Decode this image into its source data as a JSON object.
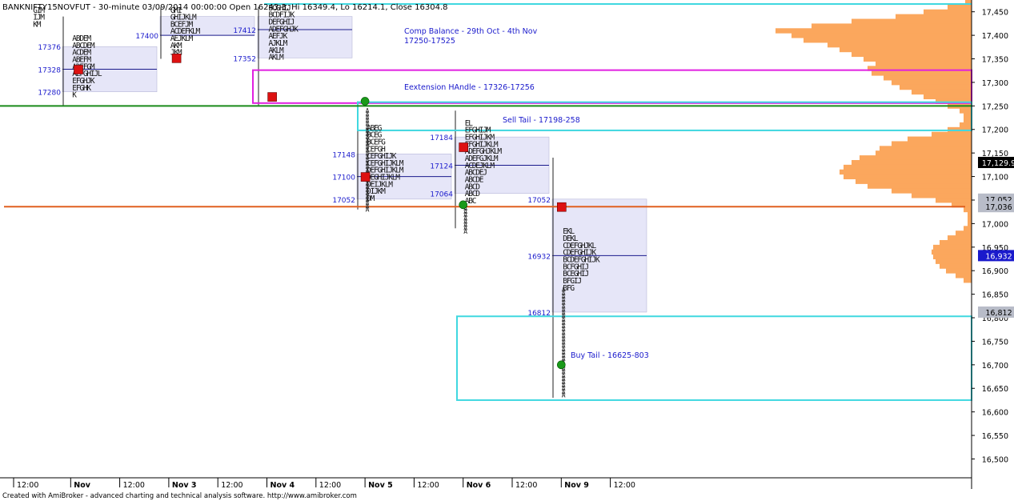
{
  "header": {
    "title": "BANKNIFTY15NOVFUT - 30-minute 03/09/2014 00:00:00 Open 16243.3, Hi 16349.4, Lo 16214.1, Close 16304.8"
  },
  "footer": {
    "credit": "Created with AmiBroker - advanced charting and technical analysis software. http://www.amibroker.com"
  },
  "colors": {
    "profile_fill": "#fba75d",
    "value_area_fill": "#e6e6f8",
    "poc_line": "#1a1a8c",
    "cyan_box": "#40d8e0",
    "magenta_box": "#e020e0",
    "green_line": "#1a8a1a",
    "orange_line": "#e06020",
    "text_blue": "#1a1acc",
    "red_marker": "#dd1111",
    "green_marker": "#1a9a1a"
  },
  "chart_data": {
    "type": "market-profile",
    "title": "BANKNIFTY15NOVFUT - 30-minute 03/09/2014 00:00:00 Open 16243.3, Hi 16349.4, Lo 16214.1, Close 16304.8",
    "xlabel": "",
    "ylabel": "",
    "ylim": [
      16460,
      17475
    ],
    "y_ticks": [
      16500,
      16550,
      16600,
      16650,
      16700,
      16750,
      16800,
      16850,
      16900,
      16950,
      17000,
      17050,
      17100,
      17150,
      17200,
      17250,
      17300,
      17350,
      17400,
      17450
    ],
    "y_tick_labels": [
      "16,500",
      "16,550",
      "16,600",
      "16,650",
      "16,700",
      "16,750",
      "16,800",
      "16,850",
      "16,900",
      "16,950",
      "17,000",
      "17,050",
      "17,100",
      "17,150",
      "17,200",
      "17,250",
      "17,300",
      "17,350",
      "17,400",
      "17,450"
    ],
    "x_labels": [
      {
        "label": "12:00",
        "slot": 0
      },
      {
        "label": "Nov",
        "slot": 1,
        "bold": true
      },
      {
        "label": "12:00",
        "slot": 2
      },
      {
        "label": "Nov 3",
        "slot": 3,
        "bold": true
      },
      {
        "label": "12:00",
        "slot": 4
      },
      {
        "label": "Nov 4",
        "slot": 5,
        "bold": true
      },
      {
        "label": "12:00",
        "slot": 6
      },
      {
        "label": "Nov 5",
        "slot": 7,
        "bold": true
      },
      {
        "label": "12:00",
        "slot": 8
      },
      {
        "label": "Nov 6",
        "slot": 9,
        "bold": true
      },
      {
        "label": "12:00",
        "slot": 10
      },
      {
        "label": "Nov 9",
        "slot": 11,
        "bold": true
      },
      {
        "label": "12:00",
        "slot": 12
      }
    ],
    "value_areas": [
      {
        "day": "Nov",
        "vah": 17376,
        "poc": 17328,
        "val": 17280,
        "hi": 17440,
        "lo": 17250,
        "poc_label": "17328",
        "vah_label": "17376",
        "val_label": "17280"
      },
      {
        "day": "Nov 3",
        "vah": 17440,
        "poc": 17400,
        "val": 17400,
        "hi": 17460,
        "lo": 17350,
        "poc_label": "17400"
      },
      {
        "day": "Nov 4",
        "vah": 17440,
        "poc": 17412,
        "val": 17352,
        "hi": 17460,
        "lo": 17250,
        "poc_label": "17412",
        "val_label": "17352"
      },
      {
        "day": "Nov 5",
        "vah": 17148,
        "poc": 17100,
        "val": 17052,
        "hi": 17260,
        "lo": 17030,
        "poc_label": "17100",
        "vah_label": "17148",
        "val_label": "17052"
      },
      {
        "day": "Nov 6",
        "vah": 17184,
        "poc": 17124,
        "val": 17064,
        "hi": 17240,
        "lo": 16990,
        "poc_label": "17124",
        "vah_label": "17184",
        "val_label": "17064"
      },
      {
        "day": "Nov 9",
        "vah": 17052,
        "poc": 16932,
        "val": 16812,
        "hi": 17140,
        "lo": 16630,
        "poc_label": "16932",
        "vah_label": "17052",
        "val_label": "16812"
      }
    ],
    "zones": [
      {
        "label": "Comp Balance - 29th Oct - 4th Nov",
        "label2": "17250-17525",
        "kind": "text",
        "y": 17410
      },
      {
        "label": "Eextension HAndle - 17326-17256",
        "kind": "magenta",
        "top": 17326,
        "bottom": 17256
      },
      {
        "label": "Sell Tail - 17198-258",
        "kind": "cyan",
        "top": 17258,
        "bottom": 17198
      },
      {
        "label": "Buy Tail - 16625-803",
        "kind": "cyan",
        "top": 16803,
        "bottom": 16625
      }
    ],
    "horizontal_lines": [
      {
        "name": "green-support-line",
        "value": 17250,
        "color": "#1a8a1a"
      },
      {
        "name": "orange-level-line",
        "value": 17036,
        "color": "#e06020"
      }
    ],
    "price_badges": [
      {
        "label": "17,129.9",
        "value": 17129.9,
        "style": "black"
      },
      {
        "label": "17,052",
        "value": 17052,
        "style": "grey"
      },
      {
        "label": "17,036",
        "value": 17036,
        "style": "grey"
      },
      {
        "label": "16,932",
        "value": 16932,
        "style": "blue"
      },
      {
        "label": "16,812",
        "value": 16812,
        "style": "grey"
      }
    ],
    "volume_profile": [
      {
        "price": 17470,
        "w": 8
      },
      {
        "price": 17460,
        "w": 30
      },
      {
        "price": 17450,
        "w": 60
      },
      {
        "price": 17440,
        "w": 95
      },
      {
        "price": 17430,
        "w": 150
      },
      {
        "price": 17420,
        "w": 200
      },
      {
        "price": 17410,
        "w": 245
      },
      {
        "price": 17400,
        "w": 225
      },
      {
        "price": 17390,
        "w": 210
      },
      {
        "price": 17380,
        "w": 180
      },
      {
        "price": 17370,
        "w": 165
      },
      {
        "price": 17360,
        "w": 150
      },
      {
        "price": 17350,
        "w": 135
      },
      {
        "price": 17340,
        "w": 120
      },
      {
        "price": 17330,
        "w": 130
      },
      {
        "price": 17320,
        "w": 125
      },
      {
        "price": 17310,
        "w": 110
      },
      {
        "price": 17300,
        "w": 100
      },
      {
        "price": 17290,
        "w": 90
      },
      {
        "price": 17280,
        "w": 75
      },
      {
        "price": 17270,
        "w": 60
      },
      {
        "price": 17260,
        "w": 45
      },
      {
        "price": 17250,
        "w": 30
      },
      {
        "price": 17240,
        "w": 15
      },
      {
        "price": 17230,
        "w": 10
      },
      {
        "price": 17220,
        "w": 10
      },
      {
        "price": 17210,
        "w": 15
      },
      {
        "price": 17200,
        "w": 30
      },
      {
        "price": 17190,
        "w": 50
      },
      {
        "price": 17180,
        "w": 80
      },
      {
        "price": 17170,
        "w": 100
      },
      {
        "price": 17160,
        "w": 115
      },
      {
        "price": 17150,
        "w": 120
      },
      {
        "price": 17140,
        "w": 140
      },
      {
        "price": 17130,
        "w": 150
      },
      {
        "price": 17120,
        "w": 160
      },
      {
        "price": 17110,
        "w": 165
      },
      {
        "price": 17100,
        "w": 160
      },
      {
        "price": 17090,
        "w": 145
      },
      {
        "price": 17080,
        "w": 130
      },
      {
        "price": 17070,
        "w": 100
      },
      {
        "price": 17060,
        "w": 75
      },
      {
        "price": 17050,
        "w": 45
      },
      {
        "price": 17040,
        "w": 25
      },
      {
        "price": 17030,
        "w": 10
      },
      {
        "price": 17020,
        "w": 5
      },
      {
        "price": 17010,
        "w": 5
      },
      {
        "price": 17000,
        "w": 5
      },
      {
        "price": 16990,
        "w": 10
      },
      {
        "price": 16980,
        "w": 20
      },
      {
        "price": 16970,
        "w": 30
      },
      {
        "price": 16960,
        "w": 40
      },
      {
        "price": 16950,
        "w": 48
      },
      {
        "price": 16940,
        "w": 50
      },
      {
        "price": 16930,
        "w": 48
      },
      {
        "price": 16920,
        "w": 45
      },
      {
        "price": 16910,
        "w": 40
      },
      {
        "price": 16900,
        "w": 32
      },
      {
        "price": 16890,
        "w": 20
      },
      {
        "price": 16880,
        "w": 10
      }
    ],
    "markers": [
      {
        "slot": 1.15,
        "price": 17328,
        "color": "red"
      },
      {
        "slot": 3.15,
        "price": 17352,
        "color": "red"
      },
      {
        "slot": 5.1,
        "price": 17270,
        "color": "red"
      },
      {
        "slot": 7.0,
        "price": 17100,
        "color": "red"
      },
      {
        "slot": 7.0,
        "price": 17260,
        "color": "green"
      },
      {
        "slot": 9.0,
        "price": 17040,
        "color": "green"
      },
      {
        "slot": 9.0,
        "price": 17163,
        "color": "red"
      },
      {
        "slot": 11.0,
        "price": 17036,
        "color": "red"
      },
      {
        "slot": 11.0,
        "price": 16700,
        "color": "green"
      }
    ],
    "tpo_rows": [
      {
        "slot": 0.2,
        "price": 17455,
        "letters": "GIM"
      },
      {
        "slot": 0.2,
        "price": 17440,
        "letters": "IJM"
      },
      {
        "slot": 0.2,
        "price": 17425,
        "letters": "KM"
      },
      {
        "slot": 1.0,
        "price": 17395,
        "letters": "ABDEM"
      },
      {
        "slot": 1.0,
        "price": 17380,
        "letters": "ABCDEM"
      },
      {
        "slot": 1.0,
        "price": 17365,
        "letters": "ACDEM"
      },
      {
        "slot": 1.0,
        "price": 17350,
        "letters": "ABEFM"
      },
      {
        "slot": 1.0,
        "price": 17335,
        "letters": "ADEFGM"
      },
      {
        "slot": 1.0,
        "price": 17320,
        "letters": "AEFGHIJL"
      },
      {
        "slot": 1.0,
        "price": 17305,
        "letters": "EFGHJK"
      },
      {
        "slot": 1.0,
        "price": 17290,
        "letters": "EFGHK"
      },
      {
        "slot": 1.0,
        "price": 17275,
        "letters": "K"
      },
      {
        "slot": 3.0,
        "price": 17455,
        "letters": "GHI"
      },
      {
        "slot": 3.0,
        "price": 17440,
        "letters": "GHIJKLM"
      },
      {
        "slot": 3.0,
        "price": 17425,
        "letters": "BCEFJM"
      },
      {
        "slot": 3.0,
        "price": 17410,
        "letters": "ACDEFKLM"
      },
      {
        "slot": 3.0,
        "price": 17395,
        "letters": "AEJKLM"
      },
      {
        "slot": 3.0,
        "price": 17380,
        "letters": "AKM"
      },
      {
        "slot": 3.0,
        "price": 17365,
        "letters": "JKM"
      },
      {
        "slot": 5.0,
        "price": 17460,
        "letters": "BCGHIJ"
      },
      {
        "slot": 5.0,
        "price": 17445,
        "letters": "BCDFIJK"
      },
      {
        "slot": 5.0,
        "price": 17430,
        "letters": "DEFGHIJ"
      },
      {
        "slot": 5.0,
        "price": 17415,
        "letters": "ADEFGHJK"
      },
      {
        "slot": 5.0,
        "price": 17400,
        "letters": "AEFJK"
      },
      {
        "slot": 5.0,
        "price": 17385,
        "letters": "AJKLM"
      },
      {
        "slot": 5.0,
        "price": 17370,
        "letters": "AKLM"
      },
      {
        "slot": 5.0,
        "price": 17355,
        "letters": "AKLM"
      },
      {
        "slot": 7.0,
        "price": 17205,
        "letters": "ABEG"
      },
      {
        "slot": 7.0,
        "price": 17190,
        "letters": "BCEG"
      },
      {
        "slot": 7.0,
        "price": 17175,
        "letters": "BCEFG"
      },
      {
        "slot": 7.0,
        "price": 17160,
        "letters": "CEFGH"
      },
      {
        "slot": 7.0,
        "price": 17145,
        "letters": "CEFGHIJK"
      },
      {
        "slot": 7.0,
        "price": 17130,
        "letters": "CEFGHIJKLM"
      },
      {
        "slot": 7.0,
        "price": 17115,
        "letters": "DEFGHIJKLM"
      },
      {
        "slot": 7.0,
        "price": 17100,
        "letters": "DEGHIJKLM"
      },
      {
        "slot": 7.0,
        "price": 17085,
        "letters": "DEIJKLM"
      },
      {
        "slot": 7.0,
        "price": 17070,
        "letters": "DIJKM"
      },
      {
        "slot": 7.0,
        "price": 17055,
        "letters": "DM"
      },
      {
        "slot": 9.0,
        "price": 17215,
        "letters": "EL"
      },
      {
        "slot": 9.0,
        "price": 17200,
        "letters": "EFGHIJM"
      },
      {
        "slot": 9.0,
        "price": 17185,
        "letters": "EFGHIJKM"
      },
      {
        "slot": 9.0,
        "price": 17170,
        "letters": "EFGHIJKLM"
      },
      {
        "slot": 9.0,
        "price": 17155,
        "letters": "ADEFGHJKLM"
      },
      {
        "slot": 9.0,
        "price": 17140,
        "letters": "ADEFGJKLM"
      },
      {
        "slot": 9.0,
        "price": 17125,
        "letters": "ACDEJKLM"
      },
      {
        "slot": 9.0,
        "price": 17110,
        "letters": "ABCDEJ"
      },
      {
        "slot": 9.0,
        "price": 17095,
        "letters": "ABCDE"
      },
      {
        "slot": 9.0,
        "price": 17080,
        "letters": "ABCD"
      },
      {
        "slot": 9.0,
        "price": 17065,
        "letters": "ABCD"
      },
      {
        "slot": 9.0,
        "price": 17050,
        "letters": "ABC"
      },
      {
        "slot": 11.0,
        "price": 16985,
        "letters": "EKL"
      },
      {
        "slot": 11.0,
        "price": 16970,
        "letters": "DEKL"
      },
      {
        "slot": 11.0,
        "price": 16955,
        "letters": "CDEFGHJKL"
      },
      {
        "slot": 11.0,
        "price": 16940,
        "letters": "CDEFGHIJK"
      },
      {
        "slot": 11.0,
        "price": 16925,
        "letters": "BCDEFGHIJK"
      },
      {
        "slot": 11.0,
        "price": 16910,
        "letters": "BCFGHIJ"
      },
      {
        "slot": 11.0,
        "price": 16895,
        "letters": "BCEGHIJ"
      },
      {
        "slot": 11.0,
        "price": 16880,
        "letters": "BFGIJ"
      },
      {
        "slot": 11.0,
        "price": 16865,
        "letters": "BFG"
      }
    ]
  }
}
